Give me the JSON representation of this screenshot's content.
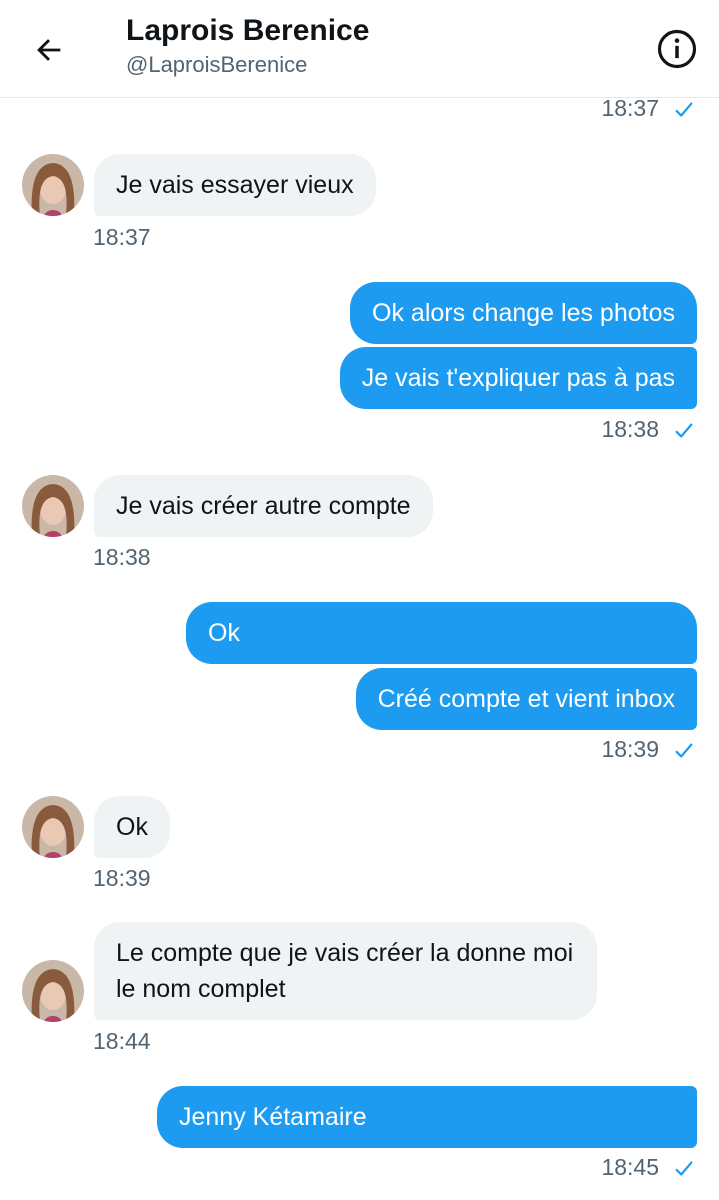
{
  "header": {
    "title": "Laprois Berenice",
    "handle": "@LaproisBerenice"
  },
  "colors": {
    "accent": "#1d9bf0",
    "incoming_bubble": "#eff3f4",
    "muted_text": "#536471"
  },
  "icons": {
    "back": "arrow-left-icon",
    "info": "info-icon",
    "read": "check-icon"
  },
  "messages": [
    {
      "timestamp": "18:37"
    },
    {
      "text": "Je vais essayer vieux",
      "timestamp": "18:37"
    },
    {
      "text": "Ok alors change les photos"
    },
    {
      "text": "Je vais t'expliquer pas à pas",
      "timestamp": "18:38"
    },
    {
      "text": "Je vais créer autre compte",
      "timestamp": "18:38"
    },
    {
      "text": "Ok"
    },
    {
      "text": "Créé compte et vient inbox",
      "timestamp": "18:39"
    },
    {
      "text": "Ok",
      "timestamp": "18:39"
    },
    {
      "text": "Le compte que je vais créer la donne moi le nom complet",
      "timestamp": "18:44"
    },
    {
      "text": "Jenny Kétamaire",
      "timestamp": "18:45"
    }
  ]
}
